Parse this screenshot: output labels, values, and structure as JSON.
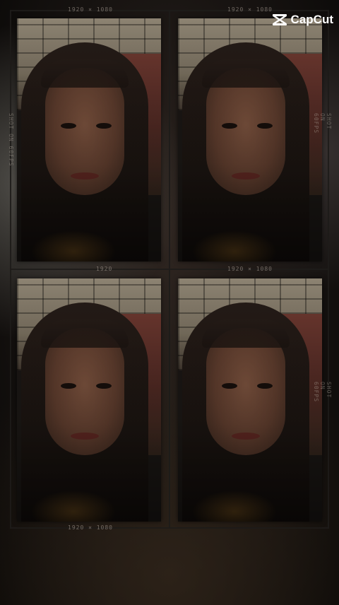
{
  "watermark": {
    "brand": "CapCut",
    "icon": "capcut-logo-icon"
  },
  "frame_labels": {
    "top_left": "1920 × 1080",
    "top_right": "1920 × 1080",
    "mid_left": "1920",
    "mid_right": "1920 × 1080",
    "bottom_left": "1920 × 1080",
    "side_left": "SHOT ON 60FPS",
    "side_right_top": "SHOT ON 60FPS",
    "side_right_bottom": "SHOT ON 60FPS"
  },
  "colors": {
    "background": "#171311",
    "frame_line": "#1e1c1a",
    "watermark": "#ffffff"
  }
}
